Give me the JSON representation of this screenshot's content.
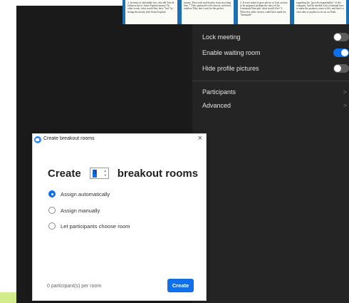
{
  "slides": [
    "3. In terms of affordable ties, who did Tom & Johnson down. Some Explain money? In other words, what would they have \"lost\" by letting the money then Some Explain",
    "money. They took used bottles from recycling bins. * They partnered with schools, investors, retailers They don't wait for the perfect",
    "2. If were asked to give advice or Tom on how to be prepared, perhaps the most of the Lemonade Principle, what would it be? 3. What else other choices could have made for \"lemonade\"",
    "regarding the \"growth responsibility\" of the company. And he needed a list of manual laws to make the products come to life, and here's a clear idea or product to focus on. Both"
  ],
  "panel": {
    "toggles": [
      {
        "label": "Lock meeting",
        "state": "off"
      },
      {
        "label": "Enable waiting room",
        "state": "on"
      },
      {
        "label": "Hide profile pictures",
        "state": "off"
      }
    ],
    "links": [
      {
        "label": "Participants",
        "chevron": ">"
      },
      {
        "label": "Advanced",
        "chevron": ">"
      }
    ]
  },
  "dialog": {
    "title": "Create breakout rooms",
    "close": "×",
    "create_word": "Create",
    "room_count": "3",
    "breakout_word": "breakout rooms",
    "options": [
      {
        "label": "Assign automatically",
        "selected": true
      },
      {
        "label": "Assign manually",
        "selected": false
      },
      {
        "label": "Let participants choose room",
        "selected": false
      }
    ],
    "footer": "0 participant(s) per room",
    "create_button": "Create"
  },
  "colors": {
    "accent": "#0e71eb",
    "panel_bg": "#242424",
    "video_bg": "#1a1a1a",
    "slide_bg": "#1e6fb0",
    "lime": "#d2ec8c"
  }
}
